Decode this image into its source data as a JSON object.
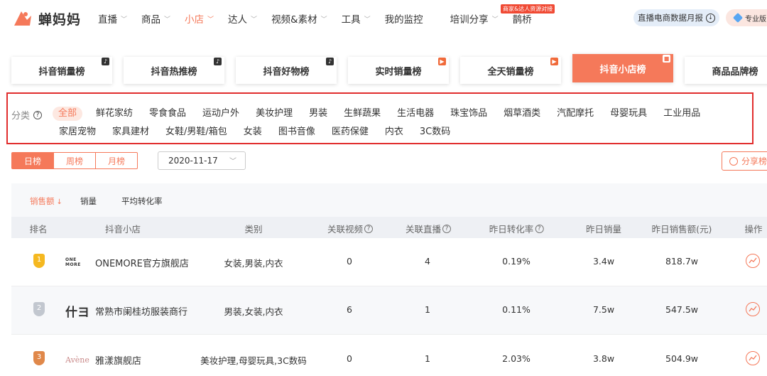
{
  "brand": {
    "name": "蝉妈妈",
    "accent": "#f5795a"
  },
  "nav": {
    "items": [
      {
        "label": "直播",
        "caret": true,
        "active": false
      },
      {
        "label": "商品",
        "caret": true,
        "active": false
      },
      {
        "label": "小店",
        "caret": true,
        "active": true
      },
      {
        "label": "达人",
        "caret": true,
        "active": false
      },
      {
        "label": "视频&素材",
        "caret": true,
        "active": false
      },
      {
        "label": "工具",
        "caret": true,
        "active": false
      },
      {
        "label": "我的监控",
        "caret": false,
        "active": false
      },
      {
        "label": "培训分享",
        "caret": true,
        "active": false
      },
      {
        "label": "鹊桥",
        "caret": false,
        "active": false
      }
    ],
    "badge": "商家&达人资源对接",
    "report_button": "直播电商数据月报",
    "pro_button": "专业版"
  },
  "boards": [
    {
      "label": "抖音销量榜",
      "icon": "douyin-icon",
      "active": false
    },
    {
      "label": "抖音热推榜",
      "icon": "douyin-icon",
      "active": false
    },
    {
      "label": "抖音好物榜",
      "icon": "douyin-icon",
      "active": false
    },
    {
      "label": "实时销量榜",
      "icon": "live-icon",
      "active": false
    },
    {
      "label": "全天销量榜",
      "icon": "live-icon",
      "active": false
    },
    {
      "label": "抖音小店榜",
      "icon": "shop-icon",
      "active": true
    },
    {
      "label": "商品品牌榜",
      "icon": "",
      "active": false
    }
  ],
  "category": {
    "label": "分类",
    "row1": [
      "全部",
      "鲜花家纺",
      "零食食品",
      "运动户外",
      "美妆护理",
      "男装",
      "生鲜蔬果",
      "生活电器",
      "珠宝饰品",
      "烟草酒类",
      "汽配摩托",
      "母婴玩具",
      "工业用品"
    ],
    "row2": [
      "家居宠物",
      "家具建材",
      "女鞋/男鞋/箱包",
      "女装",
      "图书音像",
      "医药保健",
      "内衣",
      "3C数码"
    ],
    "selected": "全部"
  },
  "period": {
    "options": [
      "日榜",
      "周榜",
      "月榜"
    ],
    "selected": "日榜"
  },
  "date": "2020-11-17",
  "share_label": "分享榜",
  "metrics": [
    "销售额",
    "销量",
    "平均转化率"
  ],
  "table": {
    "headers": [
      "排名",
      "抖音小店",
      "类别",
      "关联视频",
      "关联直播",
      "昨日转化率",
      "昨日销量",
      "昨日销售额(元)",
      "操作"
    ],
    "rows": [
      {
        "rank": "1",
        "logo_text": "ONE MORE",
        "shop": "ONEMORE官方旗舰店",
        "category": "女装,男装,内衣",
        "videos": "0",
        "lives": "4",
        "conv": "0.19%",
        "sales": "3.4w",
        "revenue": "818.7w"
      },
      {
        "rank": "2",
        "logo_text": "什ヨ",
        "shop": "常熟市阑桂坊服装商行",
        "category": "男装,女装,内衣",
        "videos": "6",
        "lives": "1",
        "conv": "0.11%",
        "sales": "7.5w",
        "revenue": "547.5w"
      },
      {
        "rank": "3",
        "logo_text": "Avène",
        "shop": "雅漾旗舰店",
        "category": "美妆护理,母婴玩具,3C数码",
        "videos": "0",
        "lives": "1",
        "conv": "2.03%",
        "sales": "3.8w",
        "revenue": "504.9w"
      }
    ]
  }
}
